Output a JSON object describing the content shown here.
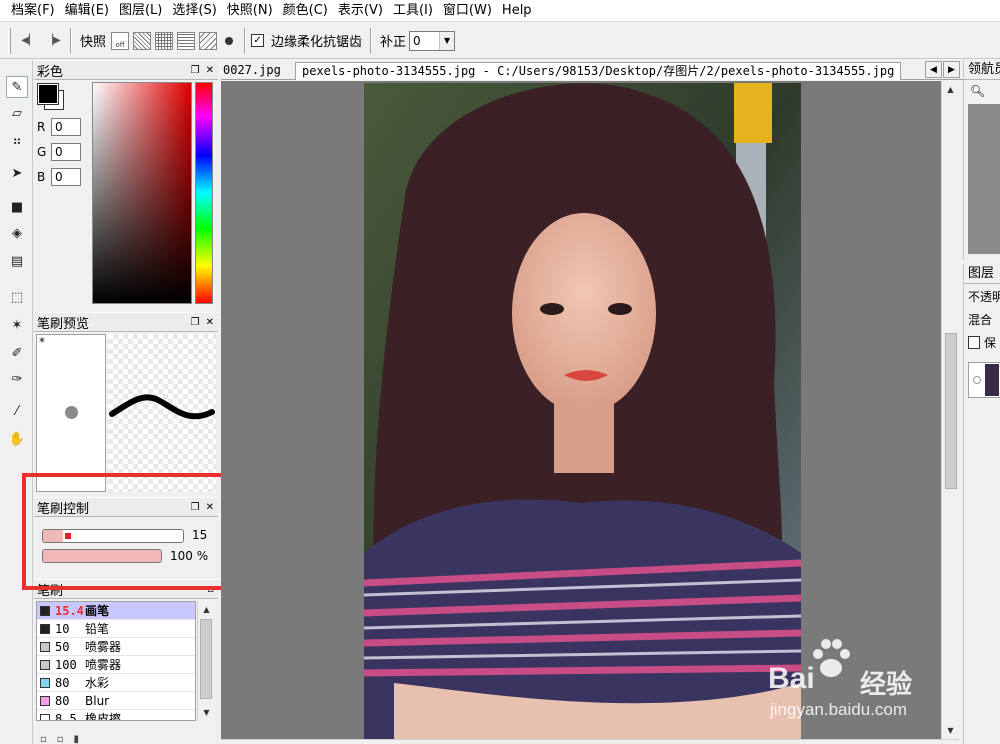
{
  "menubar": {
    "items": [
      "档案(F)",
      "编辑(E)",
      "图层(L)",
      "选择(S)",
      "快照(N)",
      "颜色(C)",
      "表示(V)",
      "工具(I)",
      "窗口(W)",
      "Help"
    ]
  },
  "toolbar": {
    "snapshot_label": "快照",
    "off_label": "off",
    "antialias_label": "边缘柔化抗锯齿",
    "antialias_checked": "✓",
    "correction_label": "补正",
    "correction_value": "0"
  },
  "color_panel": {
    "title": "彩色",
    "r_label": "R",
    "r_value": "0",
    "g_label": "G",
    "g_value": "0",
    "b_label": "B",
    "b_value": "0"
  },
  "brush_preview": {
    "title": "笔刷预览",
    "star": "*"
  },
  "brush_control": {
    "title": "笔刷控制",
    "size_value": "15",
    "size_fraction": 0.14,
    "density_value": "100 %",
    "density_fraction": 1.0
  },
  "brushes": {
    "title": "笔刷",
    "items": [
      {
        "size": "15.4",
        "name": "画笔",
        "color": "#222222"
      },
      {
        "size": "10",
        "name": "铅笔",
        "color": "#222222"
      },
      {
        "size": "50",
        "name": "喷雾器",
        "color": "#c8c8c8"
      },
      {
        "size": "100",
        "name": "喷雾器",
        "color": "#c8c8c8"
      },
      {
        "size": "80",
        "name": "水彩",
        "color": "#7fd8f0"
      },
      {
        "size": "80",
        "name": "Blur",
        "color": "#f0a0e8"
      },
      {
        "size": "8.5",
        "name": "橡皮擦",
        "color": "#ffffff"
      }
    ]
  },
  "document": {
    "prev_tab": "0027.jpg",
    "active_tab": "pexels-photo-3134555.jpg - C:/Users/98153/Desktop/存图片/2/pexels-photo-3134555.jpg"
  },
  "right_panels": {
    "navigator_title": "领航员",
    "layers_title": "图层",
    "opacity_label": "不透明度",
    "blend_label": "混合",
    "protect_label": "保"
  },
  "watermark": {
    "brand": "Bai",
    "brand_suffix": "经验",
    "url": "jingyan.baidu.com"
  },
  "colors": {
    "highlight": "#e8302f",
    "selected_row": "#c8c8ff",
    "slider_fill": "#f2b8b8"
  }
}
